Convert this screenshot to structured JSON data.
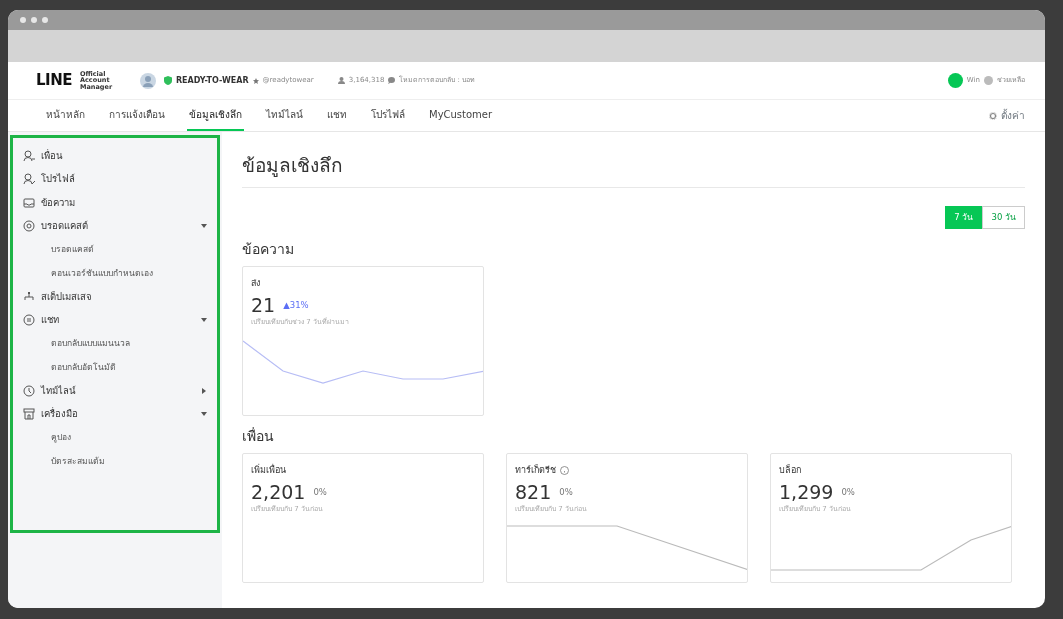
{
  "header": {
    "logo": "LINE",
    "logo_sub": "Official Account Manager",
    "account_name": "READY-TO-WEAR",
    "account_id": "@readytowear",
    "followers": "3,164,318",
    "reply_mode": "โหมดการตอบกลับ : บอท",
    "user": "Win",
    "help": "ช่วยเหลือ"
  },
  "tabs": [
    {
      "label": "หน้าหลัก",
      "selected": false
    },
    {
      "label": "การแจ้งเตือน",
      "selected": false
    },
    {
      "label": "ข้อมูลเชิงลึก",
      "selected": true
    },
    {
      "label": "ไทม์ไลน์",
      "selected": false
    },
    {
      "label": "แชท",
      "selected": false
    },
    {
      "label": "โปรไฟล์",
      "selected": false
    },
    {
      "label": "MyCustomer",
      "selected": false
    }
  ],
  "settings": "ตั้งค่า",
  "sidebar": {
    "items": [
      {
        "label": "เพื่อน"
      },
      {
        "label": "โปรไฟล์"
      },
      {
        "label": "ข้อความ"
      },
      {
        "label": "บรอดแคสต์",
        "expanded": true,
        "children": [
          {
            "label": "บรอดแคสต์"
          },
          {
            "label": "คอนเวอร์ชันแบบกำหนดเอง"
          }
        ]
      },
      {
        "label": "สเต็ปเมสเสจ"
      },
      {
        "label": "แชท",
        "expanded": true,
        "children": [
          {
            "label": "ตอบกลับแบบแมนนวล"
          },
          {
            "label": "ตอบกลับอัตโนมัติ"
          }
        ]
      },
      {
        "label": "ไทม์ไลน์",
        "expanded": false
      },
      {
        "label": "เครื่องมือ",
        "expanded": true,
        "children": [
          {
            "label": "คูปอง"
          },
          {
            "label": "บัตรสะสมแต้ม"
          }
        ]
      }
    ]
  },
  "page_title": "ข้อมูลเชิงลึก",
  "period_toggle": [
    {
      "label": "7 วัน",
      "selected": true
    },
    {
      "label": "30 วัน",
      "selected": false
    }
  ],
  "sections": [
    {
      "title": "ข้อความ",
      "cards": [
        {
          "label": "ส่ง",
          "value": "21",
          "change": "▲31%",
          "color": "#5b6ef5",
          "note": "เปรียบเทียบกับช่วง 7 วันที่ผ่านมา",
          "has_info": false
        }
      ]
    },
    {
      "title": "เพื่อน",
      "cards": [
        {
          "label": "เพิ่มเพื่อน",
          "value": "2,201",
          "change": "0%",
          "note": "เปรียบเทียบกับ 7 วันก่อน",
          "has_info": false
        },
        {
          "label": "ทาร์เก็ตรีช",
          "value": "821",
          "change": "0%",
          "note": "เปรียบเทียบกับ 7 วันก่อน",
          "has_info": true
        },
        {
          "label": "บล็อก",
          "value": "1,299",
          "change": "0%",
          "note": "เปรียบเทียบกับ 7 วันก่อน",
          "has_info": false
        }
      ]
    }
  ]
}
